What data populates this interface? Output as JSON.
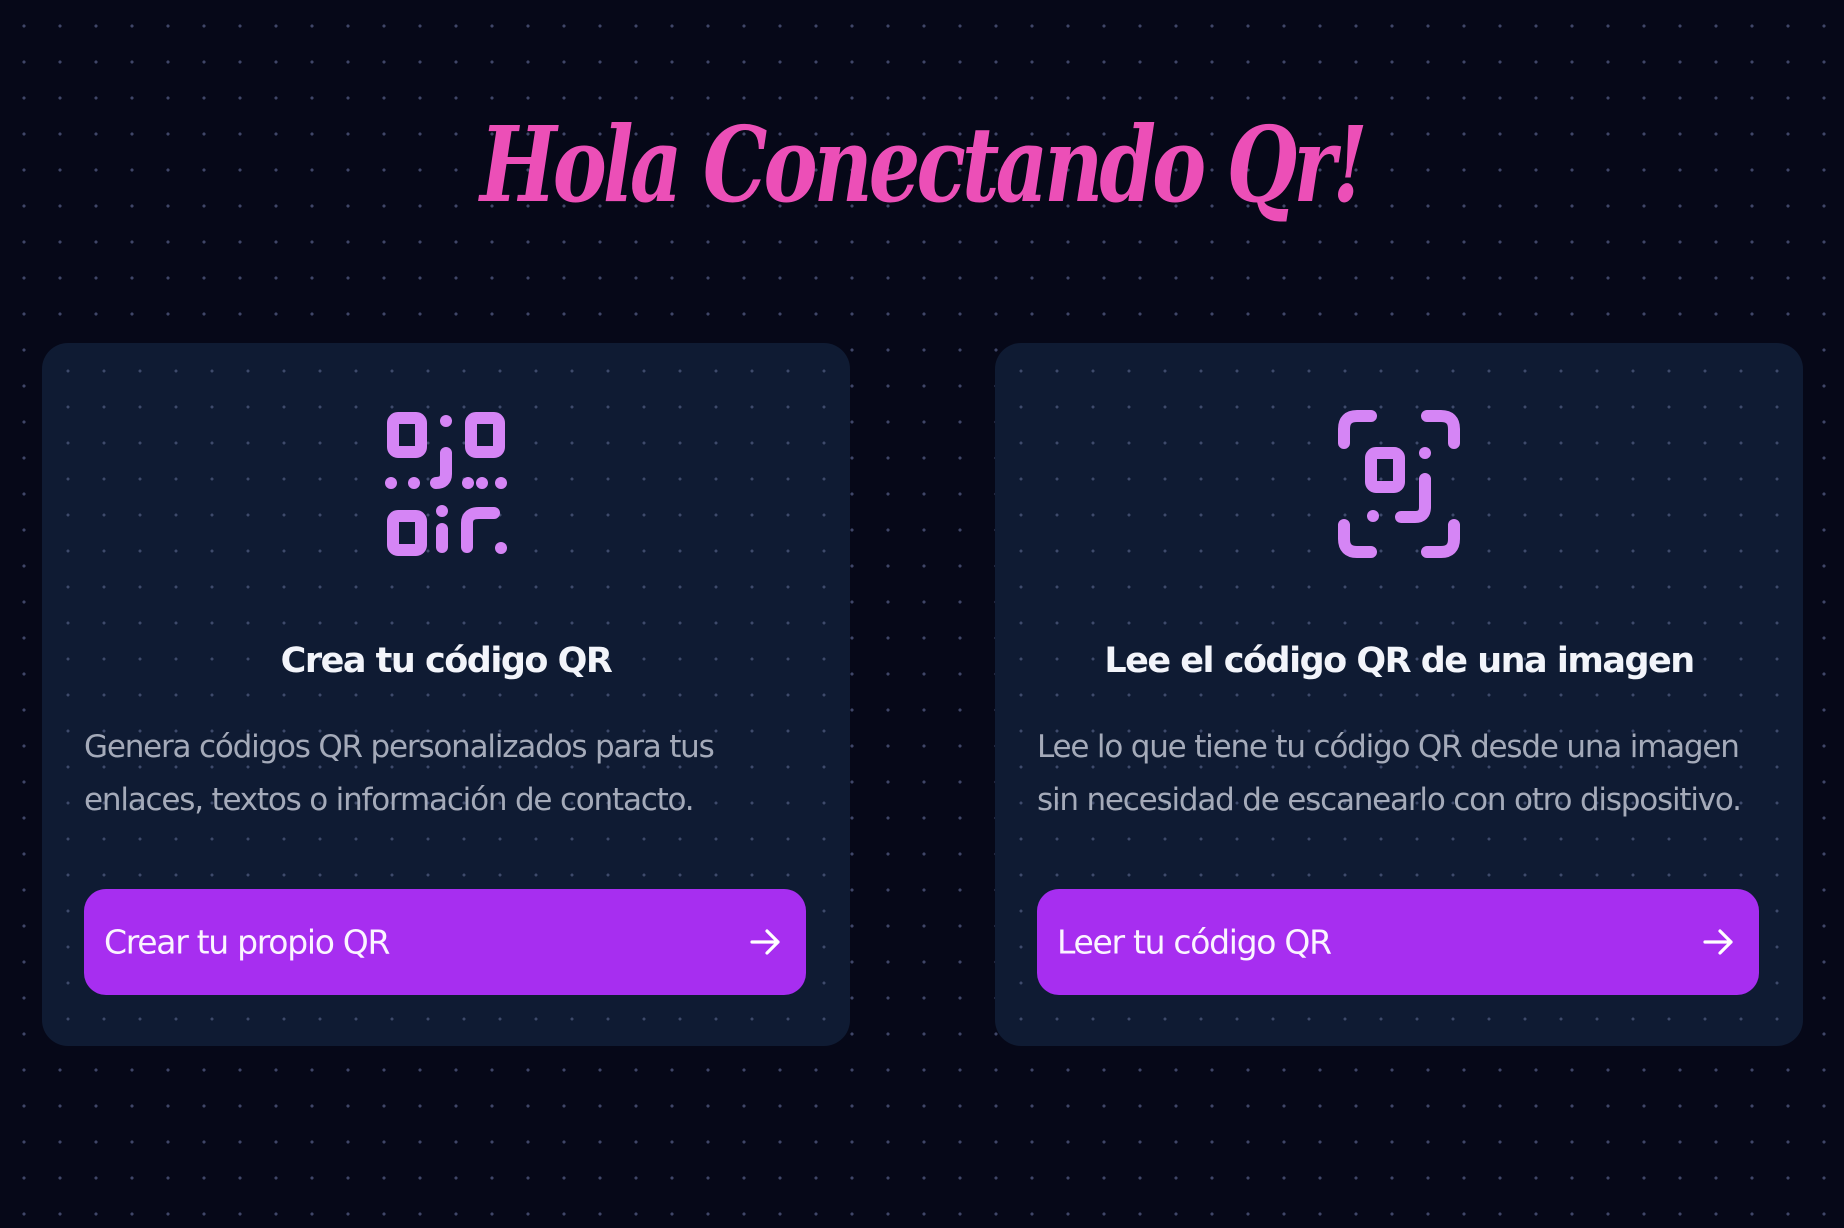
{
  "page": {
    "title": "Hola Conectando Qr!"
  },
  "colors": {
    "background": "#060818",
    "card": "#0f1b33",
    "title_pink": "#ec4fb7",
    "icon_violet": "#d585f5",
    "button_purple": "#a72ef0",
    "text_muted": "#a4aab9"
  },
  "cards": [
    {
      "icon": "qr-code-icon",
      "title": "Crea tu código QR",
      "description_lines": [
        "Genera códigos QR personalizados para tus",
        "enlaces, textos o información de contacto."
      ],
      "button_label": "Crear tu propio QR",
      "button_icon": "arrow-right-icon"
    },
    {
      "icon": "qr-scan-icon",
      "title": "Lee el código QR de una imagen",
      "description_lines": [
        "Lee lo que tiene tu código QR desde una imagen",
        "sin necesidad de escanearlo con otro dispositivo."
      ],
      "button_label": "Leer tu código QR",
      "button_icon": "arrow-right-icon"
    }
  ]
}
